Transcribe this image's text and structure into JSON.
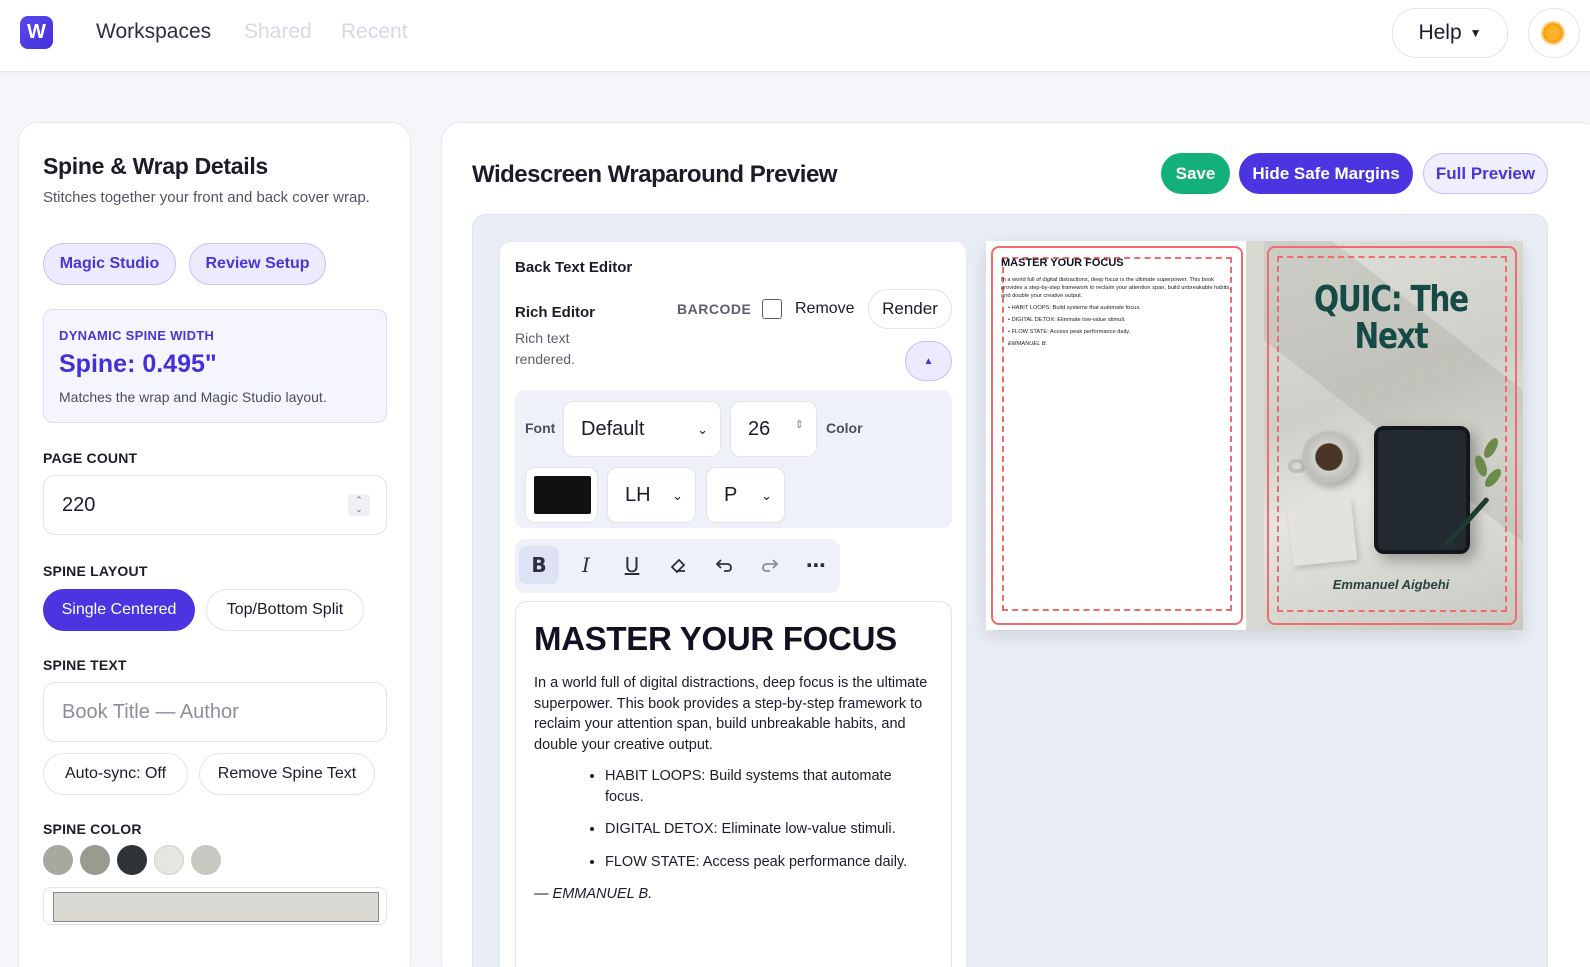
{
  "app": {
    "logo_letter": "W",
    "nav": [
      "Workspaces",
      "Shared",
      "Recent"
    ],
    "help_label": "Help",
    "help_caret": "▼"
  },
  "left_panel": {
    "title": "Spine & Wrap Details",
    "subtitle": "Stitches together your front and back cover wrap.",
    "magic_studio_label": "Magic Studio",
    "review_setup_label": "Review Setup",
    "dynamic_spine": {
      "heading": "DYNAMIC SPINE WIDTH",
      "value": "Spine: 0.495\"",
      "note": "Matches the wrap and Magic Studio layout."
    },
    "page_count_label": "PAGE COUNT",
    "page_count_value": "220",
    "spine_layout_label": "SPINE LAYOUT",
    "spine_layout_options": [
      "Single Centered",
      "Top/Bottom Split"
    ],
    "spine_layout_selected": "Single Centered",
    "spine_text_label": "SPINE TEXT",
    "spine_text_placeholder": "Book Title — Author",
    "autosync_label": "Auto-sync: Off",
    "remove_spine_text_label": "Remove Spine Text",
    "spine_color_label": "SPINE COLOR",
    "spine_swatches": [
      "#a8a8a0",
      "#9a9a8f",
      "#2e3338",
      "#e6e6e0",
      "#c8c8c0"
    ],
    "spine_color_value": "#d9d8d2"
  },
  "preview": {
    "title": "Widescreen Wraparound Preview",
    "save_label": "Save",
    "hide_margins_label": "Hide Safe Margins",
    "full_preview_label": "Full Preview"
  },
  "editor": {
    "title": "Back Text Editor",
    "rich_editor_label": "Rich Editor",
    "rich_editor_sub": "Rich text rendered.",
    "barcode_label": "BARCODE",
    "remove_label": "Remove",
    "render_label": "Render",
    "collapse_icon": "▲",
    "font_label": "Font",
    "font_value": "Default",
    "font_size": "26",
    "color_label": "Color",
    "text_color": "#111111",
    "line_height_value": "LH",
    "paragraph_value": "P",
    "toolbar_icons": [
      "bold-icon",
      "italic-icon",
      "underline-icon",
      "eraser-icon",
      "undo-icon",
      "redo-icon",
      "more-icon"
    ]
  },
  "document": {
    "heading": "MASTER YOUR FOCUS",
    "paragraph": "In a world full of digital distractions, deep focus is the ultimate superpower. This book provides a step-by-step framework to reclaim your attention span, build unbreakable habits, and double your creative output.",
    "bullets": [
      "HABIT LOOPS: Build systems that automate focus.",
      "DIGITAL DETOX: Eliminate low-value stimuli.",
      "FLOW STATE: Access peak performance daily."
    ],
    "signature": "— EMMANUEL B."
  },
  "cover": {
    "back_heading": "MASTER YOUR FOCUS",
    "back_paragraph": "In a world full of digital distractions, deep focus is the ultimate superpower. This book provides a step-by-step framework to reclaim your attention span, build unbreakable habits, and double your creative output.",
    "back_bullets": [
      "HABIT LOOPS: Build systems that automate focus.",
      "DIGITAL DETOX: Eliminate low-value stimuli.",
      "FLOW STATE: Access peak performance daily."
    ],
    "back_signature": "EMMANUEL B.",
    "front_title": "QUIC: The Next",
    "front_author": "Emmanuel Aigbehi"
  },
  "colors": {
    "accent": "#4a35e0",
    "save_green": "#13b07a",
    "safe_margin": "#f06b6b",
    "title_teal": "#154a46"
  }
}
